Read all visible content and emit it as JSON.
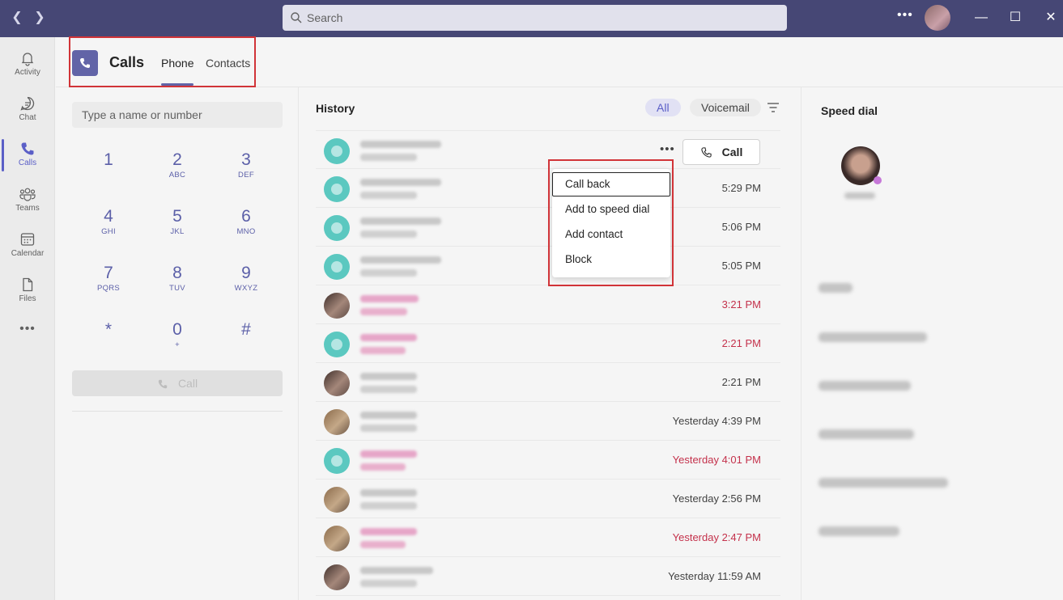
{
  "titlebar": {
    "search_placeholder": "Search"
  },
  "rail": {
    "items": [
      {
        "label": "Activity",
        "icon": "bell-icon"
      },
      {
        "label": "Chat",
        "icon": "chat-icon"
      },
      {
        "label": "Calls",
        "icon": "phone-icon",
        "active": true
      },
      {
        "label": "Teams",
        "icon": "teams-icon"
      },
      {
        "label": "Calendar",
        "icon": "calendar-icon"
      },
      {
        "label": "Files",
        "icon": "file-icon"
      }
    ]
  },
  "header": {
    "title": "Calls",
    "tabs": [
      {
        "label": "Phone",
        "active": true
      },
      {
        "label": "Contacts",
        "active": false
      }
    ]
  },
  "dialpad": {
    "input_placeholder": "Type a name or number",
    "keys": [
      {
        "num": "1",
        "sub": ""
      },
      {
        "num": "2",
        "sub": "ABC"
      },
      {
        "num": "3",
        "sub": "DEF"
      },
      {
        "num": "4",
        "sub": "GHI"
      },
      {
        "num": "5",
        "sub": "JKL"
      },
      {
        "num": "6",
        "sub": "MNO"
      },
      {
        "num": "7",
        "sub": "PQRS"
      },
      {
        "num": "8",
        "sub": "TUV"
      },
      {
        "num": "9",
        "sub": "WXYZ"
      },
      {
        "num": "*",
        "sub": ""
      },
      {
        "num": "0",
        "sub": "+"
      },
      {
        "num": "#",
        "sub": ""
      }
    ],
    "call_label": "Call"
  },
  "history": {
    "title": "History",
    "filters": [
      "All",
      "Voicemail"
    ],
    "row_call_label": "Call",
    "rows": [
      {
        "time": "",
        "missed": false
      },
      {
        "time": "5:29 PM",
        "missed": false
      },
      {
        "time": "5:06 PM",
        "missed": false
      },
      {
        "time": "5:05 PM",
        "missed": false
      },
      {
        "time": "3:21 PM",
        "missed": true
      },
      {
        "time": "2:21 PM",
        "missed": true
      },
      {
        "time": "2:21 PM",
        "missed": false
      },
      {
        "time": "Yesterday 4:39 PM",
        "missed": false
      },
      {
        "time": "Yesterday 4:01 PM",
        "missed": true
      },
      {
        "time": "Yesterday 2:56 PM",
        "missed": false
      },
      {
        "time": "Yesterday 2:47 PM",
        "missed": true
      },
      {
        "time": "Yesterday 11:59 AM",
        "missed": false
      }
    ]
  },
  "context_menu": {
    "items": [
      "Call back",
      "Add to speed dial",
      "Add contact",
      "Block"
    ]
  },
  "speed_dial": {
    "title": "Speed dial"
  },
  "colors": {
    "titlebar": "#464775",
    "accent": "#6264a7",
    "missed": "#c4314b",
    "highlight_box": "#d13438"
  }
}
